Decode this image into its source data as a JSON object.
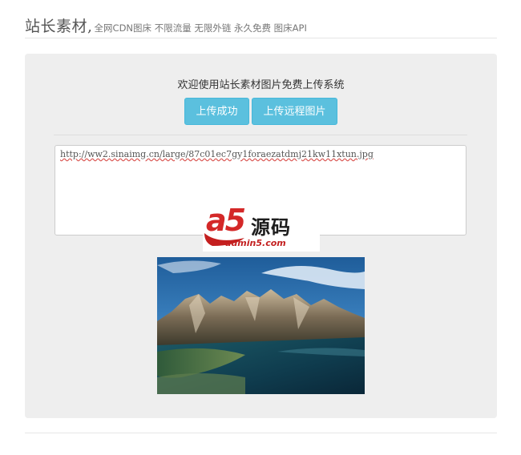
{
  "header": {
    "brand": "站长素材,",
    "tagline": "全网CDN图床 不限流量 无限外链 永久免费 图床API"
  },
  "main": {
    "welcome": "欢迎使用站长素材图片免费上传系统",
    "buttons": {
      "upload_success": "上传成功",
      "upload_remote": "上传远程图片"
    },
    "url_value": "http://ww2.sinaimg.cn/large/87c01ec7gy1foraezatdmj21kw11xtun.jpg"
  },
  "watermark": {
    "logo_letters": "a5",
    "logo_cn": "源码",
    "logo_domain": "admin5.com"
  },
  "image": {
    "subject": "mountain lake landscape"
  },
  "colors": {
    "button": "#5bc0de",
    "panel": "#eeeeee",
    "watermark_red": "#d42828"
  }
}
